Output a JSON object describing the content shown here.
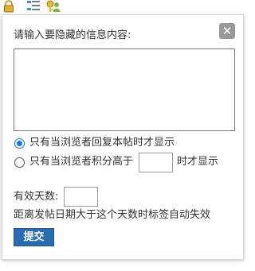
{
  "toolbar": {
    "icons": [
      "lock-icon",
      "list-indent-icon",
      "key-user-icon"
    ]
  },
  "dialog": {
    "close_label": "✕",
    "prompt": "请输入要隐藏的信息内容:",
    "content_value": "",
    "option_reply_label": "只有当浏览者回复本帖时才显示",
    "option_reply_checked": true,
    "option_points_prefix": "只有当浏览者积分高于",
    "option_points_suffix": "时才显示",
    "option_points_checked": false,
    "points_value": "",
    "valid_days_label": "有效天数:",
    "valid_days_value": "",
    "valid_days_hint": "距离发帖日期大于这个天数时标签自动失效",
    "submit_label": "提交"
  },
  "colors": {
    "accent": "#1a73e8",
    "submit_bg": "#2b6cb0",
    "close_bg": "#999999"
  }
}
